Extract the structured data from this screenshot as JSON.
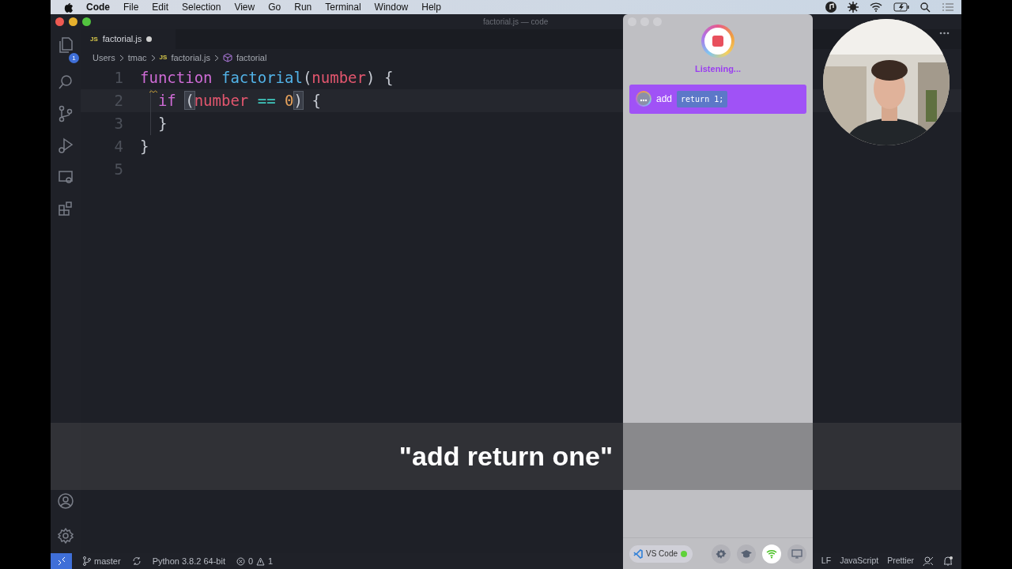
{
  "menubar": {
    "app": "Code",
    "items": [
      "File",
      "Edit",
      "Selection",
      "View",
      "Go",
      "Run",
      "Terminal",
      "Window",
      "Help"
    ]
  },
  "window": {
    "title": "factorial.js — code"
  },
  "activity_bar": {
    "explorer_badge": "1"
  },
  "tabs": [
    {
      "label": "factorial.js",
      "file_type": "JS",
      "selected": true,
      "modified": true
    }
  ],
  "breadcrumb": [
    {
      "kind": "folder",
      "label": "Users"
    },
    {
      "kind": "folder",
      "label": "tmac"
    },
    {
      "kind": "file",
      "file_type": "JS",
      "label": "factorial.js"
    },
    {
      "kind": "symbol",
      "label": "factorial"
    }
  ],
  "editor": {
    "lines": [
      {
        "number": "1",
        "current": false,
        "warning": false,
        "tokens": [
          {
            "text": "function ",
            "kind": "keyword",
            "highlight": false
          },
          {
            "text": "factorial",
            "kind": "function",
            "highlight": false
          },
          {
            "text": "(",
            "kind": "punct",
            "highlight": false
          },
          {
            "text": "number",
            "kind": "param",
            "highlight": false
          },
          {
            "text": ") {",
            "kind": "punct",
            "highlight": false
          }
        ]
      },
      {
        "number": "2",
        "current": true,
        "warning": true,
        "tokens": [
          {
            "text": "  if ",
            "kind": "keyword",
            "highlight": false
          },
          {
            "text": "(",
            "kind": "punct",
            "highlight": true
          },
          {
            "text": "number ",
            "kind": "param",
            "highlight": false
          },
          {
            "text": "== ",
            "kind": "operator",
            "highlight": false
          },
          {
            "text": "0",
            "kind": "number",
            "highlight": false
          },
          {
            "text": ")",
            "kind": "punct",
            "highlight": true
          },
          {
            "text": " {",
            "kind": "punct",
            "highlight": false
          }
        ]
      },
      {
        "number": "3",
        "current": false,
        "warning": false,
        "tokens": [
          {
            "text": "  }",
            "kind": "punct",
            "highlight": false
          }
        ]
      },
      {
        "number": "4",
        "current": false,
        "warning": false,
        "tokens": [
          {
            "text": "}",
            "kind": "punct",
            "highlight": false
          }
        ]
      },
      {
        "number": "5",
        "current": false,
        "warning": false
      }
    ]
  },
  "voice_panel": {
    "status": "Listening...",
    "command": {
      "verb": "add",
      "code": "return 1;"
    },
    "app": {
      "label": "VS Code",
      "connected": true
    },
    "toolbar": [
      {
        "kind": "settings",
        "selected": false
      },
      {
        "kind": "learn",
        "selected": false
      },
      {
        "kind": "wifi",
        "selected": true
      },
      {
        "kind": "screen",
        "selected": false
      }
    ]
  },
  "caption": "\"add return one\"",
  "status_bar": {
    "branch": "master",
    "python": "Python 3.8.2 64-bit",
    "errors": "0",
    "warnings": "1",
    "right": [
      "LF",
      "JavaScript",
      "Prettier"
    ]
  }
}
